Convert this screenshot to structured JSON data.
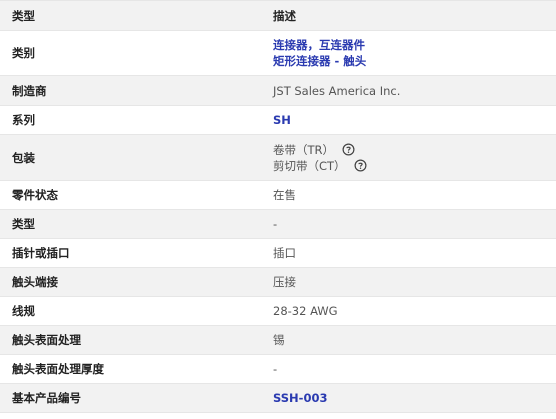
{
  "header": {
    "label": "类型",
    "value": "描述"
  },
  "rows": {
    "category": {
      "label": "类别",
      "links": [
        "连接器，互连器件",
        "矩形连接器 - 触头"
      ]
    },
    "manufacturer": {
      "label": "制造商",
      "value": "JST Sales America Inc."
    },
    "series": {
      "label": "系列",
      "value": "SH"
    },
    "packaging": {
      "label": "包装",
      "options": [
        "卷带（TR）",
        "剪切带（CT）"
      ],
      "icon": "help-circle-icon"
    },
    "part_status": {
      "label": "零件状态",
      "value": "在售"
    },
    "type": {
      "label": "类型",
      "value": "-"
    },
    "pin_or_socket": {
      "label": "插针或插口",
      "value": "插口"
    },
    "contact_termination": {
      "label": "触头端接",
      "value": "压接"
    },
    "wire_gauge": {
      "label": "线规",
      "value": "28-32 AWG"
    },
    "contact_finish": {
      "label": "触头表面处理",
      "value": "锡"
    },
    "contact_finish_thickness": {
      "label": "触头表面处理厚度",
      "value": "-"
    },
    "base_product_number": {
      "label": "基本产品编号",
      "value": "SSH-003"
    }
  },
  "colors": {
    "link": "#2a3ab0",
    "stripe": "#f2f2f2",
    "border": "#e6e6e6"
  }
}
